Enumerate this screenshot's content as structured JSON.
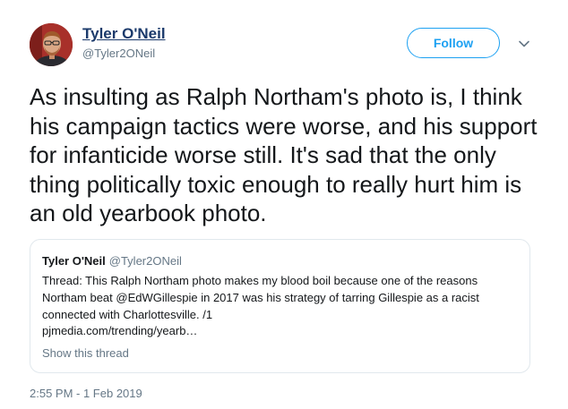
{
  "author": {
    "name": "Tyler O'Neil",
    "handle": "@Tyler2ONeil"
  },
  "follow_label": "Follow",
  "tweet_text": "As insulting as Ralph Northam's photo is, I think his campaign tactics were worse, and his support for infanticide worse still. It's sad that the only thing politically toxic enough to really hurt him is an old yearbook photo.",
  "quote": {
    "name": "Tyler O'Neil",
    "handle": "@Tyler2ONeil",
    "text": "Thread: This Ralph Northam photo makes my blood boil because one of the reasons Northam beat @EdWGillespie in 2017 was his strategy of tarring Gillespie as a racist connected with Charlottesville. /1",
    "link": "pjmedia.com/trending/yearb…",
    "show_thread": "Show this thread"
  },
  "timestamp": "2:55 PM - 1 Feb 2019",
  "icons": {
    "more": "chevron-down-icon"
  },
  "colors": {
    "accent": "#1da1f2",
    "name_link": "#1b3a6b",
    "secondary_text": "#657786",
    "border": "#e1e8ed"
  }
}
